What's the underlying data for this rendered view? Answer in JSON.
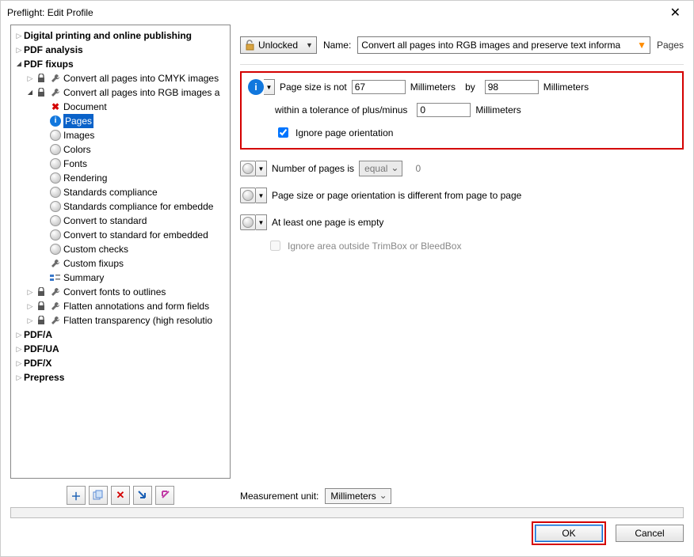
{
  "window": {
    "title": "Preflight: Edit Profile"
  },
  "tree": {
    "top": [
      {
        "label": "Digital printing and online publishing",
        "caret": "closed",
        "bold": true
      },
      {
        "label": "PDF analysis",
        "caret": "closed",
        "bold": true
      }
    ],
    "fixups_label": "PDF fixups",
    "children": {
      "cmyk": "Convert all pages into CMYK images",
      "rgb": "Convert all pages into RGB images a",
      "sub": {
        "document": "Document",
        "pages": "Pages",
        "images": "Images",
        "colors": "Colors",
        "fonts": "Fonts",
        "rendering": "Rendering",
        "std": "Standards compliance",
        "std_emb": "Standards compliance for embedde",
        "conv_std": "Convert to standard",
        "conv_std_emb": "Convert to standard for embedded",
        "custom_checks": "Custom checks",
        "custom_fixups": "Custom fixups",
        "summary": "Summary"
      },
      "fonts_outlines": "Convert fonts to outlines",
      "flatten_ann": "Flatten annotations and form fields",
      "flatten_trans": "Flatten transparency (high resolutio"
    },
    "bottom": [
      {
        "label": "PDF/A",
        "caret": "closed",
        "bold": true
      },
      {
        "label": "PDF/UA",
        "caret": "closed",
        "bold": true
      },
      {
        "label": "PDF/X",
        "caret": "closed",
        "bold": true
      },
      {
        "label": "Prepress",
        "caret": "closed",
        "bold": true
      }
    ]
  },
  "top": {
    "unlocked": "Unlocked",
    "name_label": "Name:",
    "name_value": "Convert all pages into RGB images and preserve text informa",
    "crumb": "Pages"
  },
  "p1": {
    "title": "Page size is not",
    "w": "67",
    "unit1": "Millimeters",
    "by": "by",
    "h": "98",
    "unit2": "Millimeters",
    "tol_label": "within a tolerance of plus/minus",
    "tol": "0",
    "tol_unit": "Millimeters",
    "ignore": "Ignore page orientation"
  },
  "p2": {
    "title": "Number of pages is",
    "op": "equal",
    "val": "0"
  },
  "p3": {
    "title": "Page size or page orientation is different from page to page"
  },
  "p4": {
    "title": "At least one page is empty",
    "sub": "Ignore area outside TrimBox or BleedBox"
  },
  "mu": {
    "label": "Measurement unit:",
    "value": "Millimeters"
  },
  "buttons": {
    "ok": "OK",
    "cancel": "Cancel"
  }
}
